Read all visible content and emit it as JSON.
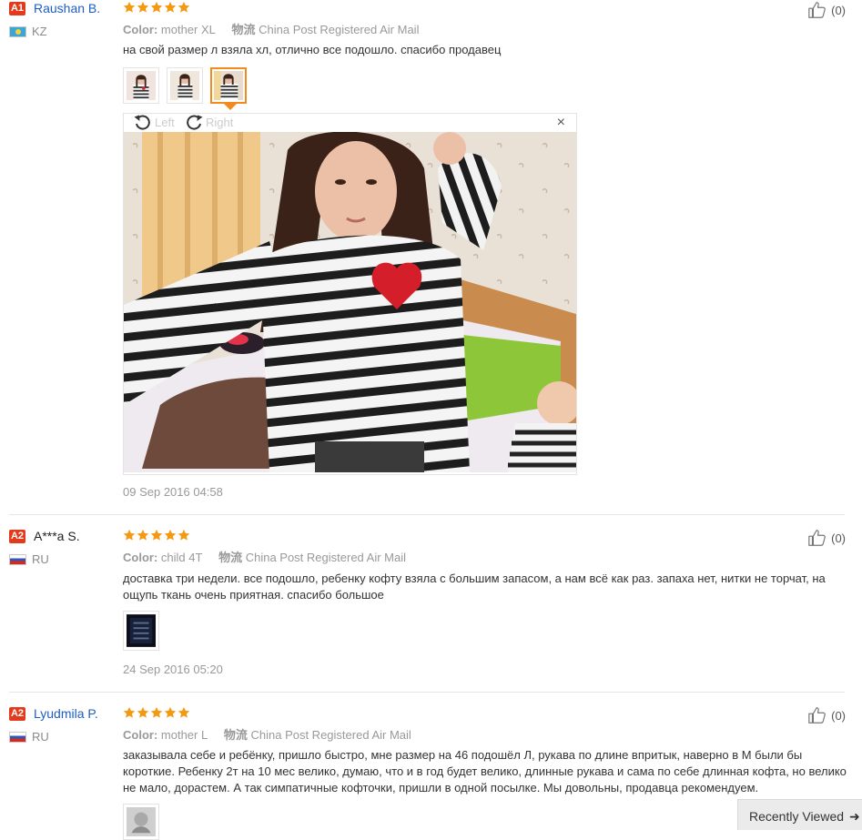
{
  "colors": {
    "name_link": "#1d5ec4",
    "star": "#f49a12",
    "level_badge": "#e33a1d",
    "muted": "#999999"
  },
  "reviews": [
    {
      "level": "A1",
      "name": "Raushan B.",
      "country": "KZ",
      "rating": 5,
      "color_label": "Color:",
      "color_value": "mother XL",
      "shipping_label": "物流",
      "shipping_value": "China Post Registered Air Mail",
      "text": "на свой размер л взяла хл, отлично все подошло. спасибо продавец",
      "date": "09 Sep 2016 04:58",
      "likes": "(0)",
      "photo_count": 3,
      "active_photo": 3
    },
    {
      "level": "A2",
      "name": "A***a S.",
      "country": "RU",
      "rating": 5,
      "color_label": "Color:",
      "color_value": "child 4T",
      "shipping_label": "物流",
      "shipping_value": "China Post Registered Air Mail",
      "text": "доставка три недели. все подошло, ребенку кофту взяла с большим запасом, а нам всё как раз. запаха нет, нитки не торчат, на ощупь ткань очень приятная. спасибо большое",
      "date": "24 Sep 2016 05:20",
      "likes": "(0)",
      "photo_count": 1
    },
    {
      "level": "A2",
      "name": "Lyudmila P.",
      "country": "RU",
      "rating": 5,
      "color_label": "Color:",
      "color_value": "mother L",
      "shipping_label": "物流",
      "shipping_value": "China Post Registered Air Mail",
      "text": "заказывала себе и ребёнку, пришло быстро, мне размер на 46 подошёл Л, рукава по длине впритык, наверно в М были бы короткие. Ребенку 2т на 10 мес велико, думаю, что и в год будет велико, длинные рукава и сама по себе длинная кофта, но велико не мало, дорастем. А так симпатичные кофточки, пришли в одной посылке. Мы довольны, продавца рекомендуем.",
      "likes": "(0)",
      "photo_count": 1
    }
  ],
  "viewer": {
    "rotate_left": "Left",
    "rotate_right": "Right",
    "close": "×"
  },
  "recently_viewed": {
    "label": "Recently Viewed"
  },
  "icons": [
    "thumbs-up-icon",
    "star-icon",
    "rotate-left-icon",
    "rotate-right-icon",
    "close-icon",
    "flag-icon",
    "arrow-right-icon"
  ]
}
